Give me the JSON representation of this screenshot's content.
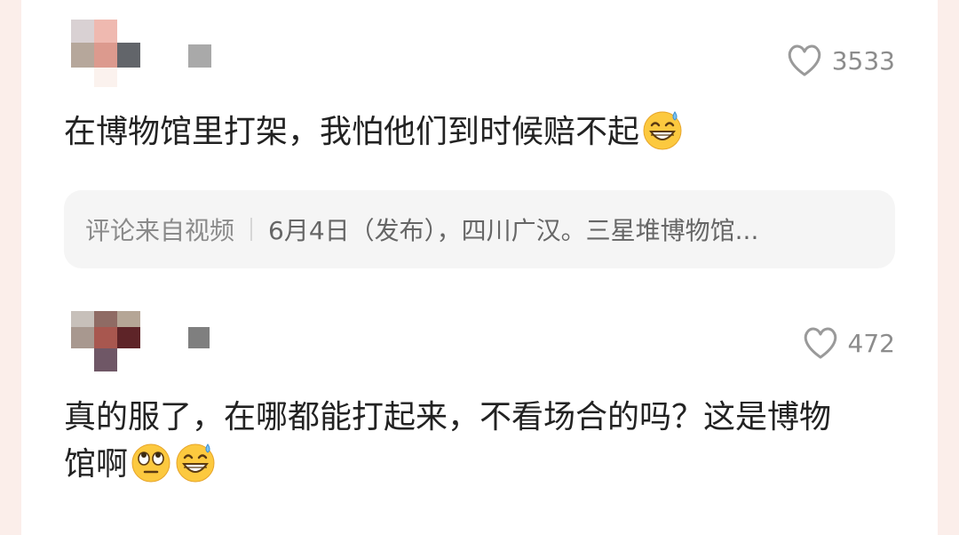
{
  "comments": [
    {
      "like_count": "3533",
      "text": "在博物馆里打架，我怕他们到时候赔不起",
      "emojis": [
        "grin-sweat-emoji"
      ],
      "source": {
        "label": "评论来自视频",
        "title": "6月4日（发布），四川广汉。三星堆博物馆..."
      }
    },
    {
      "like_count": "472",
      "text_line1": "真的服了，在哪都能打起来，不看场合的吗？这是博物",
      "text_line2": "馆啊",
      "emojis": [
        "eye-roll-emoji",
        "grin-sweat-emoji"
      ]
    }
  ],
  "colors": {
    "page_bg": "#fbeeea",
    "card_bg": "#ffffff",
    "text": "#222222",
    "muted": "#8c8c8c",
    "source_bg": "#f5f5f5"
  },
  "icons": [
    "heart-outline-icon",
    "grin-sweat-emoji",
    "eye-roll-emoji"
  ]
}
